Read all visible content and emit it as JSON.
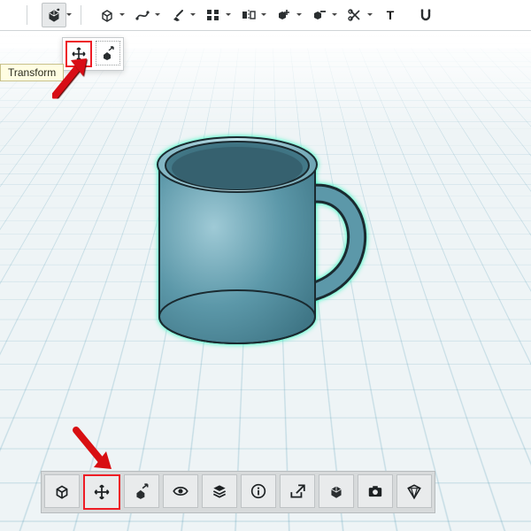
{
  "tooltip_transform": "Transform",
  "top_toolbar": {
    "transform_cube": "Transform group",
    "box_tool": "Solid primitive",
    "curve_tool": "Sketch curve",
    "brush_tool": "Paint",
    "cube_array": "Array copy",
    "mirror_cubes": "Mirror",
    "cube_plus": "Boolean add",
    "cube_minus": "Boolean subtract",
    "scissors": "Cut",
    "text_tool": "Text",
    "magnet_tool": "Snap"
  },
  "sub_toolbar": {
    "move": "Move / Translate",
    "scale": "Scale"
  },
  "bottom_toolbar": {
    "home_view": "Fit view",
    "move": "Move",
    "scale": "Scale",
    "visibility": "Show / Hide",
    "layers": "Layers",
    "info": "Info",
    "share": "Export",
    "solid": "Solid shading",
    "camera": "Screenshot",
    "render": "Render"
  },
  "model": {
    "object": "Mug",
    "selected": true,
    "highlight_color": "#05e1a2"
  }
}
